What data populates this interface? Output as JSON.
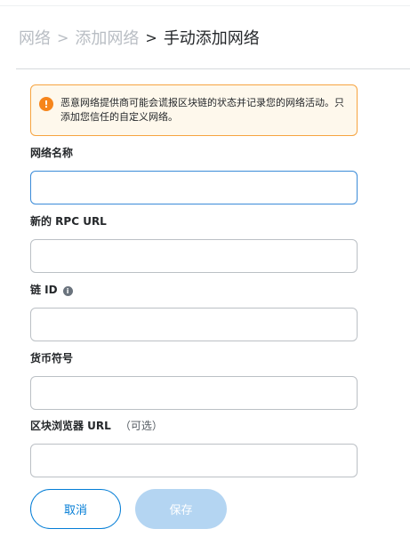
{
  "breadcrumb": {
    "items": [
      "网络",
      "添加网络",
      "手动添加网络"
    ],
    "separator": ">"
  },
  "warning": {
    "icon": "warning-icon",
    "icon_glyph": "!",
    "text": "恶意网络提供商可能会谎报区块链的状态并记录您的网络活动。只添加您信任的自定义网络。"
  },
  "form": {
    "network_name": {
      "label": "网络名称",
      "value": ""
    },
    "rpc_url": {
      "label": "新的 RPC URL",
      "value": ""
    },
    "chain_id": {
      "label": "链 ID",
      "value": "",
      "info_glyph": "i"
    },
    "currency_symbol": {
      "label": "货币符号",
      "value": ""
    },
    "explorer_url": {
      "label": "区块浏览器 URL",
      "optional": "（可选）",
      "value": ""
    }
  },
  "buttons": {
    "cancel": "取消",
    "save": "保存"
  },
  "colors": {
    "primary": "#037dd6",
    "warning_border": "#f6a440",
    "warning_bg": "#fef8ec",
    "warning_icon": "#f6851b",
    "focus_border": "#3b8bd8",
    "disabled_button": "#b4d5f2"
  }
}
